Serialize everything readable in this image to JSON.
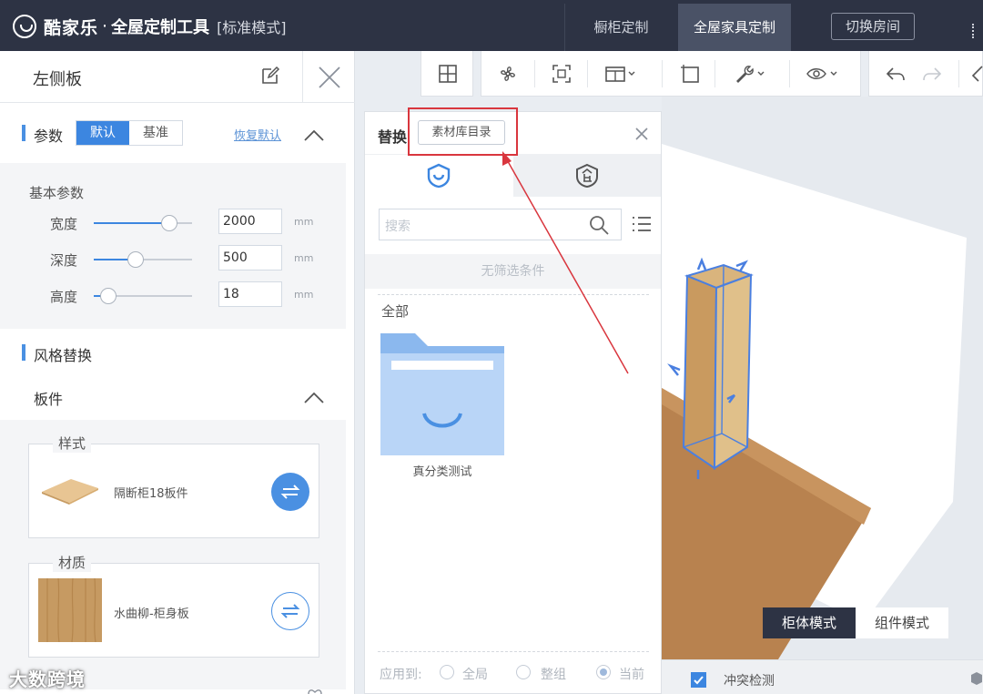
{
  "topbar": {
    "brand_name": "酷家乐",
    "brand_sep": "·",
    "tool_name": "全屋定制工具",
    "mode": "[标准模式]",
    "tab_cabinet": "橱柜定制",
    "tab_wholehouse": "全屋家具定制",
    "switch_room": "切换房间",
    "colors": {
      "bar": "#2d3344",
      "accent": "#3c86e0"
    }
  },
  "left_panel": {
    "title": "左侧板",
    "params_label": "参数",
    "seg_default": "默认",
    "seg_base": "基准",
    "restore_default": "恢复默认",
    "basic_params": "基本参数",
    "params": [
      {
        "label": "宽度",
        "value": "2000",
        "unit": "mm",
        "slider_fraction": 0.77
      },
      {
        "label": "深度",
        "value": "500",
        "unit": "mm",
        "slider_fraction": 0.43
      },
      {
        "label": "高度",
        "value": "18",
        "unit": "mm",
        "slider_fraction": 0.15
      }
    ],
    "style_replace": "风格替换",
    "board_label": "板件",
    "style_group": {
      "legend": "样式",
      "name": "隔断柜18板件"
    },
    "material_group": {
      "legend": "材质",
      "name": "水曲柳-柜身板"
    },
    "watermark": "大数跨境"
  },
  "replace_panel": {
    "title": "替换",
    "library_button": "素材库目录",
    "search_placeholder": "搜索",
    "no_filter": "无筛选条件",
    "all_label": "全部",
    "folder_name": "真分类测试",
    "apply_to": "应用到:",
    "options": [
      "全局",
      "整组",
      "当前"
    ]
  },
  "viewport": {
    "mode_cabinet": "柜体模式",
    "mode_component": "组件模式",
    "collision_check": "冲突检测"
  }
}
